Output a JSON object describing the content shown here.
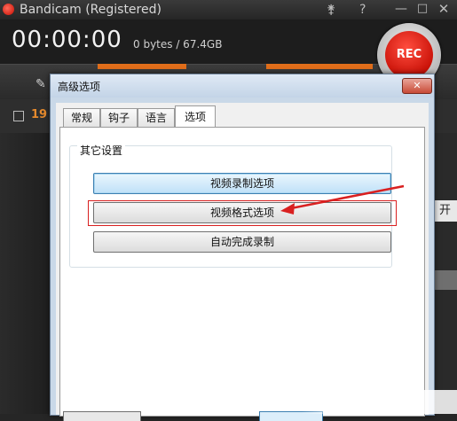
{
  "app": {
    "title": "Bandicam (Registered)",
    "key_icon": "key-icon",
    "help_label": "?",
    "min_label": "—",
    "max_label": "□",
    "close_label": "✕"
  },
  "status": {
    "timer": "00:00:00",
    "size": "0 bytes / 67.4GB",
    "rec_label": "REC"
  },
  "subbar": {
    "number": "19"
  },
  "right_panel": {
    "label": "开"
  },
  "dialog": {
    "title": "高级选项",
    "close_label": "✕",
    "tabs": [
      {
        "label": "常规"
      },
      {
        "label": "钩子"
      },
      {
        "label": "语言"
      },
      {
        "label": "选项"
      }
    ],
    "active_tab": "选项",
    "group_label": "其它设置",
    "buttons": [
      {
        "label": "视频录制选项"
      },
      {
        "label": "视频格式选项"
      },
      {
        "label": "自动完成录制"
      }
    ]
  },
  "colors": {
    "accent_orange": "#e06d1a",
    "rec_red": "#c70f05",
    "annotation_red": "#d92020"
  }
}
